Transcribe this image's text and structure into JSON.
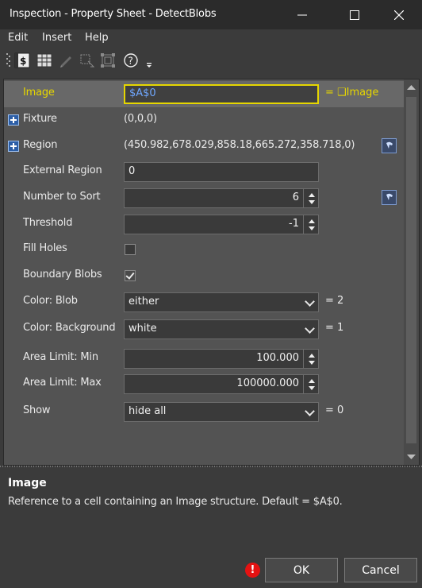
{
  "window": {
    "title": "Inspection - Property Sheet - DetectBlobs",
    "minimize_icon": "minimize-icon",
    "maximize_icon": "maximize-icon",
    "close_icon": "close-icon"
  },
  "menu": [
    "Edit",
    "Insert",
    "Help"
  ],
  "toolbar": {
    "icons": [
      "grip-icon",
      "formula-icon",
      "table-icon",
      "pen-icon",
      "region-select-icon",
      "fit-region-icon",
      "help-icon",
      "overflow-chevron-icon"
    ]
  },
  "properties": [
    {
      "label": "Image",
      "value": "$A$0",
      "suffix": "= ❑Image",
      "kind": "text",
      "selected": true
    },
    {
      "label": "Fixture",
      "value": "(0,0,0)",
      "kind": "static",
      "expandable": true
    },
    {
      "label": "Region",
      "value": "(450.982,678.029,858.18,665.272,358.718,0)",
      "kind": "static",
      "expandable": true,
      "has_button": true
    },
    {
      "label": "External Region",
      "value": "0",
      "kind": "text"
    },
    {
      "label": "Number to Sort",
      "value": "6",
      "kind": "spin",
      "has_button": true
    },
    {
      "label": "Threshold",
      "value": "-1",
      "kind": "spin"
    },
    {
      "label": "Fill Holes",
      "value": "",
      "kind": "checkbox",
      "checked": false
    },
    {
      "label": "Boundary Blobs",
      "value": "",
      "kind": "checkbox",
      "checked": true
    },
    {
      "label": "Color: Blob",
      "value": "either",
      "suffix": "= 2",
      "kind": "dropdown"
    },
    {
      "label": "Color: Background",
      "value": "white",
      "suffix": "= 1",
      "kind": "dropdown"
    },
    {
      "label": "Area Limit: Min",
      "value": "100.000",
      "kind": "spin"
    },
    {
      "label": "Area Limit: Max",
      "value": "100000.000",
      "kind": "spin"
    },
    {
      "label": "Show",
      "value": "hide all",
      "suffix": "= 0",
      "kind": "dropdown"
    }
  ],
  "description": {
    "title": "Image",
    "text": "Reference to a cell containing an Image structure. Default = $A$0."
  },
  "buttons": {
    "warning": "!",
    "ok": "OK",
    "cancel": "Cancel"
  },
  "colors": {
    "highlight_label": "#e6d600",
    "selected_row": "#686868",
    "value_link": "#6fa7ff",
    "warning": "#e51212"
  }
}
